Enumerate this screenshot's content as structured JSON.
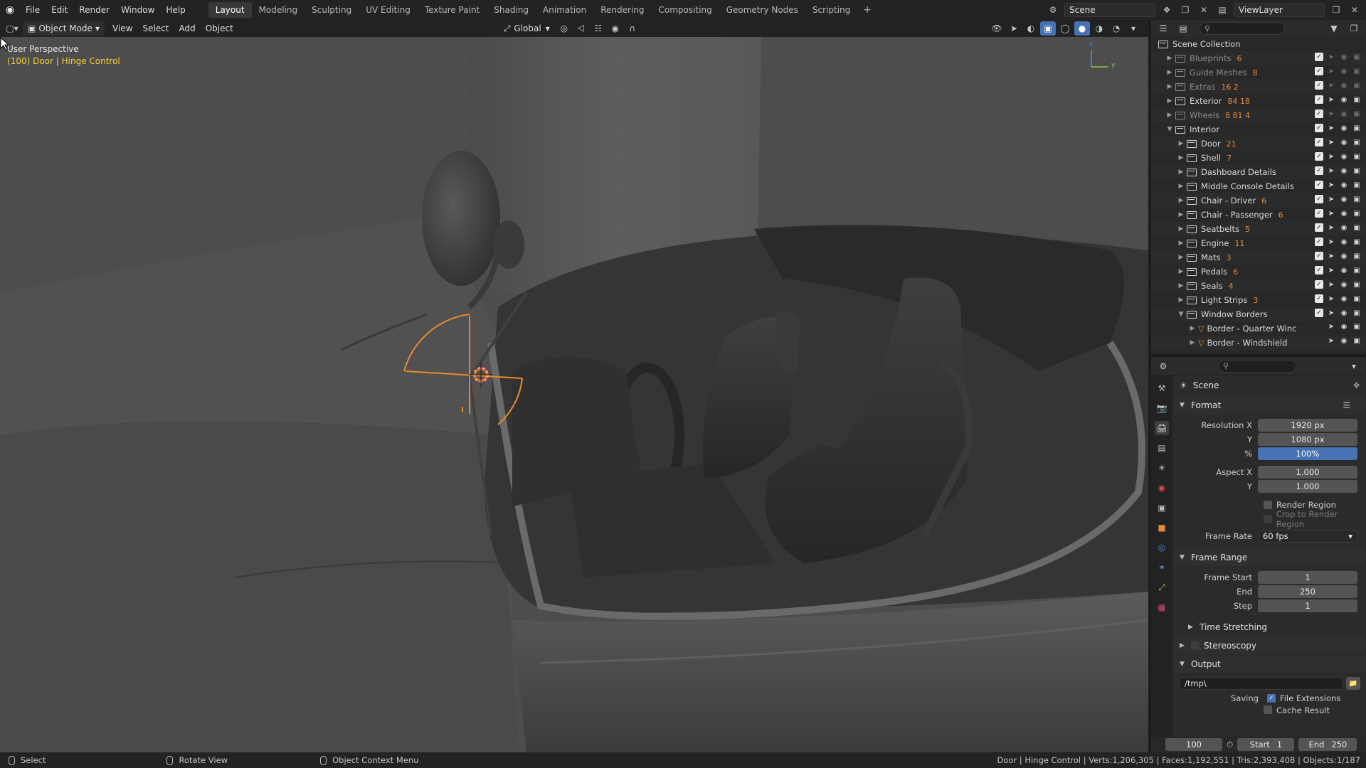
{
  "topbar": {
    "menus": [
      "File",
      "Edit",
      "Render",
      "Window",
      "Help"
    ],
    "workspaces": [
      "Layout",
      "Modeling",
      "Sculpting",
      "UV Editing",
      "Texture Paint",
      "Shading",
      "Animation",
      "Rendering",
      "Compositing",
      "Geometry Nodes",
      "Scripting"
    ],
    "active_workspace": "Layout",
    "add_workspace": "+",
    "scene_name": "Scene",
    "view_layer": "ViewLayer"
  },
  "viewport_header": {
    "mode": "Object Mode",
    "menus": [
      "View",
      "Select",
      "Add",
      "Object"
    ],
    "transform_orientation": "Global"
  },
  "viewport": {
    "perspective_label": "User Perspective",
    "object_label": "(100) Door | Hinge Control",
    "gizmo_z": "z",
    "gizmo_y": "y"
  },
  "outliner": {
    "root": "Scene Collection",
    "rows": [
      {
        "name": "Blueprints",
        "badge": "6",
        "dim": true,
        "indent": 1,
        "type": "collection",
        "expanded": false
      },
      {
        "name": "Guide Meshes",
        "badge": "8",
        "dim": true,
        "indent": 1,
        "type": "collection",
        "expanded": false
      },
      {
        "name": "Extras",
        "badge": "16 2",
        "dim": true,
        "indent": 1,
        "type": "collection",
        "expanded": false
      },
      {
        "name": "Exterior",
        "badge": "84 18",
        "dim": false,
        "indent": 1,
        "type": "collection",
        "expanded": false
      },
      {
        "name": "Wheels",
        "badge": "8 81 4",
        "dim": true,
        "indent": 1,
        "type": "collection",
        "expanded": false
      },
      {
        "name": "Interior",
        "badge": "",
        "dim": false,
        "indent": 1,
        "type": "collection",
        "expanded": true
      },
      {
        "name": "Door",
        "badge": "21",
        "dim": false,
        "indent": 2,
        "type": "collection",
        "expanded": false
      },
      {
        "name": "Shell",
        "badge": "7",
        "dim": false,
        "indent": 2,
        "type": "collection",
        "expanded": false
      },
      {
        "name": "Dashboard Details",
        "badge": "",
        "dim": false,
        "indent": 2,
        "type": "collection",
        "expanded": false
      },
      {
        "name": "Middle Console Details",
        "badge": "",
        "dim": false,
        "indent": 2,
        "type": "collection",
        "expanded": false
      },
      {
        "name": "Chair - Driver",
        "badge": "6",
        "dim": false,
        "indent": 2,
        "type": "collection",
        "expanded": false
      },
      {
        "name": "Chair - Passenger",
        "badge": "6",
        "dim": false,
        "indent": 2,
        "type": "collection",
        "expanded": false
      },
      {
        "name": "Seatbelts",
        "badge": "5",
        "dim": false,
        "indent": 2,
        "type": "collection",
        "expanded": false
      },
      {
        "name": "Engine",
        "badge": "11",
        "dim": false,
        "indent": 2,
        "type": "collection",
        "expanded": false
      },
      {
        "name": "Mats",
        "badge": "3",
        "dim": false,
        "indent": 2,
        "type": "collection",
        "expanded": false
      },
      {
        "name": "Pedals",
        "badge": "6",
        "dim": false,
        "indent": 2,
        "type": "collection",
        "expanded": false
      },
      {
        "name": "Seals",
        "badge": "4",
        "dim": false,
        "indent": 2,
        "type": "collection",
        "expanded": false
      },
      {
        "name": "Light Strips",
        "badge": "3",
        "dim": false,
        "indent": 2,
        "type": "collection",
        "expanded": false
      },
      {
        "name": "Window Borders",
        "badge": "",
        "dim": false,
        "indent": 2,
        "type": "collection",
        "expanded": true
      },
      {
        "name": "Border - Quarter Winc",
        "badge": "",
        "dim": false,
        "indent": 3,
        "type": "mesh",
        "expanded": false
      },
      {
        "name": "Border - Windshield",
        "badge": "",
        "dim": false,
        "indent": 3,
        "type": "mesh",
        "expanded": false
      }
    ]
  },
  "properties": {
    "scene_label": "Scene",
    "format": {
      "title": "Format",
      "resolution_x_label": "Resolution X",
      "resolution_x": "1920 px",
      "resolution_y_label": "Y",
      "resolution_y": "1080 px",
      "percent_label": "%",
      "percent": "100%",
      "aspect_x_label": "Aspect X",
      "aspect_x": "1.000",
      "aspect_y_label": "Y",
      "aspect_y": "1.000",
      "render_region": "Render Region",
      "crop_region": "Crop to Render Region",
      "frame_rate_label": "Frame Rate",
      "frame_rate": "60 fps"
    },
    "frame_range": {
      "title": "Frame Range",
      "start_label": "Frame Start",
      "start": "1",
      "end_label": "End",
      "end": "250",
      "step_label": "Step",
      "step": "1",
      "time_stretching": "Time Stretching"
    },
    "stereoscopy": "Stereoscopy",
    "output": {
      "title": "Output",
      "path": "/tmp\\",
      "saving_label": "Saving",
      "file_extensions": "File Extensions",
      "cache_result": "Cache Result"
    }
  },
  "timeline": {
    "current_frame": "100",
    "start_label": "Start",
    "start": "1",
    "end_label": "End",
    "end": "250"
  },
  "statusbar": {
    "select": "Select",
    "rotate": "Rotate View",
    "context": "Object Context Menu",
    "stats": "Door | Hinge Control | Verts:1,206,305 | Faces:1,192,551 | Tris:2,393,408 | Objects:1/187"
  },
  "colors": {
    "accent_blue": "#4772b3",
    "selection_orange": "#e88a2a",
    "active_text_yellow": "#f2d33a"
  }
}
